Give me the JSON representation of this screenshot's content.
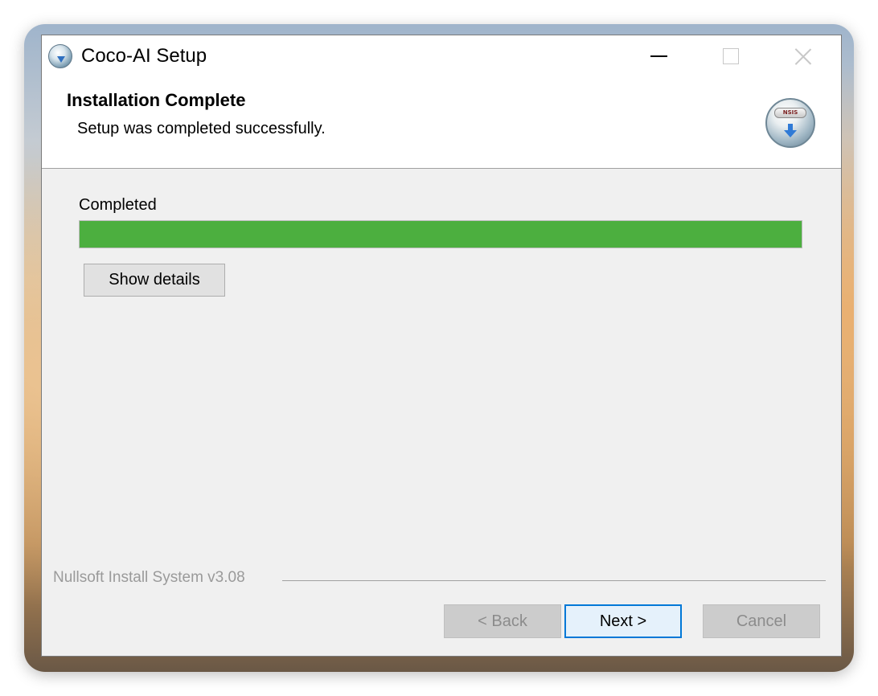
{
  "window": {
    "title": "Coco-AI Setup",
    "app_icon": "installer-globe-icon",
    "controls": {
      "minimize_icon": "minimize-icon",
      "maximize_icon": "maximize-icon",
      "close_icon": "close-icon"
    }
  },
  "header": {
    "title": "Installation Complete",
    "subtitle": "Setup was completed successfully.",
    "logo_label": "NSIS",
    "logo_icon": "nsis-logo-icon"
  },
  "content": {
    "status_label": "Completed",
    "progress": 1.0,
    "progress_color": "#4caf3f",
    "show_details_label": "Show details"
  },
  "footer": {
    "branding": "Nullsoft Install System v3.08",
    "back_label": "< Back",
    "next_label": "Next >",
    "cancel_label": "Cancel"
  }
}
